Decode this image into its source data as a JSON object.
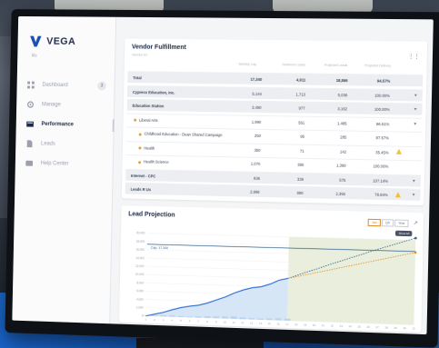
{
  "app": {
    "name": "VEGA"
  },
  "sidebar": {
    "items": [
      {
        "label": "Dashboard",
        "badge": "3",
        "active": false,
        "icon": "grid-icon"
      },
      {
        "label": "Manage",
        "badge": "",
        "active": false,
        "icon": "gear-icon"
      },
      {
        "label": "Performance",
        "badge": "",
        "active": true,
        "icon": "chart-icon"
      },
      {
        "label": "Leads",
        "badge": "",
        "active": false,
        "icon": "document-icon"
      },
      {
        "label": "Help Center",
        "badge": "",
        "active": false,
        "icon": "help-icon"
      }
    ]
  },
  "fulfillment": {
    "title": "Vendor Fulfillment",
    "subtitle": "Vendor ID",
    "columns": [
      "Monthly Cap",
      "Delivered Leads",
      "Projected Leads",
      "Projected Delivery"
    ],
    "rows": [
      {
        "label": "Total",
        "c1": "17,340",
        "c2": "4,911",
        "c3": "18,866",
        "c4": "94.57%",
        "style": "total",
        "warn": false,
        "chev": false,
        "dot": false
      },
      {
        "label": "Cypress Education, Inc.",
        "c1": "5,144",
        "c2": "1,713",
        "c3": "5,036",
        "c4": "100.00%",
        "style": "gray",
        "warn": false,
        "chev": true,
        "dot": false
      },
      {
        "label": "Education Station",
        "c1": "3,490",
        "c2": "977",
        "c3": "3,162",
        "c4": "100.00%",
        "style": "gray",
        "warn": false,
        "chev": true,
        "dot": false
      },
      {
        "label": "Liberal Arts",
        "c1": "1,990",
        "c2": "551",
        "c3": "1,485",
        "c4": "96.61%",
        "style": "sub",
        "warn": false,
        "chev": true,
        "dot": true
      },
      {
        "label": "Childhood Education - Dean Shared Campaign",
        "c1": "250",
        "c2": "95",
        "c3": "285",
        "c4": "97.57%",
        "style": "subsub",
        "warn": false,
        "chev": false,
        "dot": true
      },
      {
        "label": "Health",
        "c1": "350",
        "c2": "71",
        "c3": "142",
        "c4": "35.45%",
        "style": "subsub",
        "warn": true,
        "chev": false,
        "dot": true
      },
      {
        "label": "Health Science",
        "c1": "1,070",
        "c2": "366",
        "c3": "1,390",
        "c4": "100.00%",
        "style": "subsub",
        "warn": false,
        "chev": false,
        "dot": true
      },
      {
        "label": "Internet - CPC",
        "c1": "936",
        "c2": "339",
        "c3": "575",
        "c4": "107.14%",
        "style": "gray",
        "warn": false,
        "chev": true,
        "dot": false
      },
      {
        "label": "Leads R Us",
        "c1": "2,996",
        "c2": "880",
        "c3": "2,392",
        "c4": "78.84%",
        "style": "gray",
        "warn": true,
        "chev": true,
        "dot": false
      }
    ]
  },
  "projection": {
    "title": "Lead Projection",
    "toggles": [
      "Jan",
      "Qtr",
      "Year"
    ],
    "active_toggle": "Jan",
    "cap_label": "Cap: 17,340",
    "chip": "Show All"
  },
  "chart_data": {
    "type": "line",
    "title": "Lead Projection",
    "x": [
      1,
      2,
      3,
      4,
      5,
      6,
      7,
      8,
      9,
      10,
      11,
      12,
      13,
      14,
      15,
      16,
      17,
      18,
      19,
      20,
      21,
      22,
      23,
      24,
      25,
      26,
      27,
      28,
      29,
      30,
      31
    ],
    "series": [
      {
        "name": "",
        "values": [
          0,
          500,
          1000,
          1700,
          2300,
          2700,
          3000,
          3600,
          4400,
          5200,
          6200,
          7000,
          7600,
          7900,
          8600,
          9600,
          10100,
          null,
          null,
          null,
          null,
          null,
          null,
          null,
          null,
          null,
          null,
          null,
          null,
          null,
          null
        ],
        "color": "#2a6bd6"
      },
      {
        "name": "",
        "values": [
          null,
          null,
          null,
          null,
          null,
          null,
          null,
          null,
          null,
          null,
          null,
          null,
          null,
          null,
          null,
          null,
          10100,
          10900,
          11700,
          12400,
          13200,
          14000,
          14700,
          15500,
          16200,
          17000,
          17700,
          18400,
          19100,
          19800,
          20500
        ],
        "color": "#2f5f8a",
        "dash": true
      },
      {
        "name": "",
        "values": [
          null,
          null,
          null,
          null,
          null,
          null,
          null,
          null,
          null,
          null,
          null,
          null,
          null,
          null,
          null,
          null,
          10100,
          10600,
          11100,
          11600,
          12100,
          12600,
          13100,
          13600,
          14100,
          14600,
          15100,
          15600,
          16100,
          16600,
          17100
        ],
        "color": "#e28a2a",
        "dash": true
      }
    ],
    "daily_bars": [
      150,
      200,
      300,
      350,
      250,
      200,
      300,
      400,
      450,
      500,
      600,
      450,
      350,
      300,
      400,
      500,
      450
    ],
    "cap": 17340,
    "ylim": [
      0,
      20000
    ],
    "yticks": [
      0,
      2000,
      4000,
      6000,
      8000,
      10000,
      12000,
      14000,
      16000,
      18000,
      20000
    ],
    "colors": {
      "actual": "#2a6bd6",
      "actual_fill": "#d6e6f7",
      "projection_fill": "#e9efdc",
      "cap_line": "#2f5f8a"
    }
  }
}
